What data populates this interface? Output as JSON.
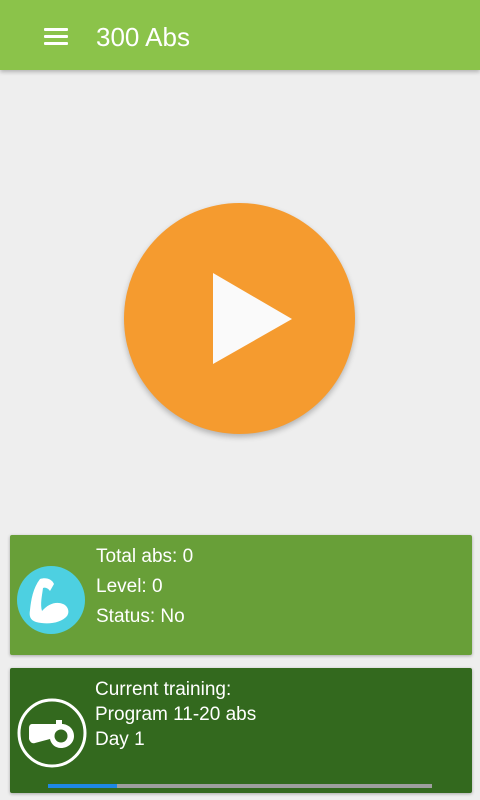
{
  "app_bar": {
    "title": "300 Abs",
    "menu_icon": "hamburger-menu-icon",
    "color": "#8bc34a"
  },
  "play": {
    "icon": "play-icon",
    "color": "#f59b2f"
  },
  "stats": {
    "icon": "flexed-arm-icon",
    "total_abs": "Total abs: 0",
    "level": "Level: 0",
    "status": "Status: No",
    "color": "#689f38"
  },
  "training": {
    "icon": "whistle-icon",
    "heading": "Current training:",
    "program": "Program 11-20 abs",
    "day": "Day 1",
    "progress": 0.18,
    "color": "#33691e"
  }
}
